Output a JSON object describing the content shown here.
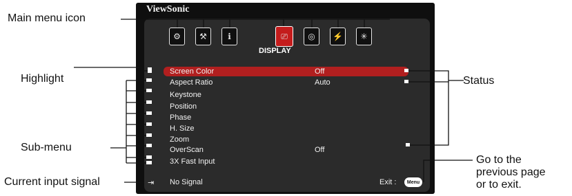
{
  "osd": {
    "brand": "ViewSonic",
    "tabs": [
      "settings-icon",
      "tools-icon",
      "info-icon",
      "display-icon",
      "image-icon",
      "power-icon",
      "options-icon"
    ],
    "active_tab_label": "DISPLAY",
    "items": [
      {
        "label": "Screen Color",
        "value": "Off"
      },
      {
        "label": "Aspect Ratio",
        "value": "Auto"
      },
      {
        "label": "Keystone",
        "value": ""
      },
      {
        "label": "Position",
        "value": ""
      },
      {
        "label": "Phase",
        "value": ""
      },
      {
        "label": "H. Size",
        "value": ""
      },
      {
        "label": "Zoom",
        "value": ""
      },
      {
        "label": "OverScan",
        "value": "Off"
      },
      {
        "label": "3X Fast Input",
        "value": ""
      }
    ],
    "input_signal": "No Signal",
    "exit_label": "Exit :",
    "menu_button": "Menu"
  },
  "callouts": {
    "main_menu_icon": "Main menu icon",
    "highlight": "Highlight",
    "status": "Status",
    "sub_menu": "Sub-menu",
    "current_input_signal": "Current input signal",
    "go_back_line1": "Go to the",
    "go_back_line2": "previous page",
    "go_back_line3": "or to exit."
  },
  "colors": {
    "highlight": "#b11f1f",
    "active_icon": "#c41c1c",
    "panel": "#2b2b2b"
  }
}
